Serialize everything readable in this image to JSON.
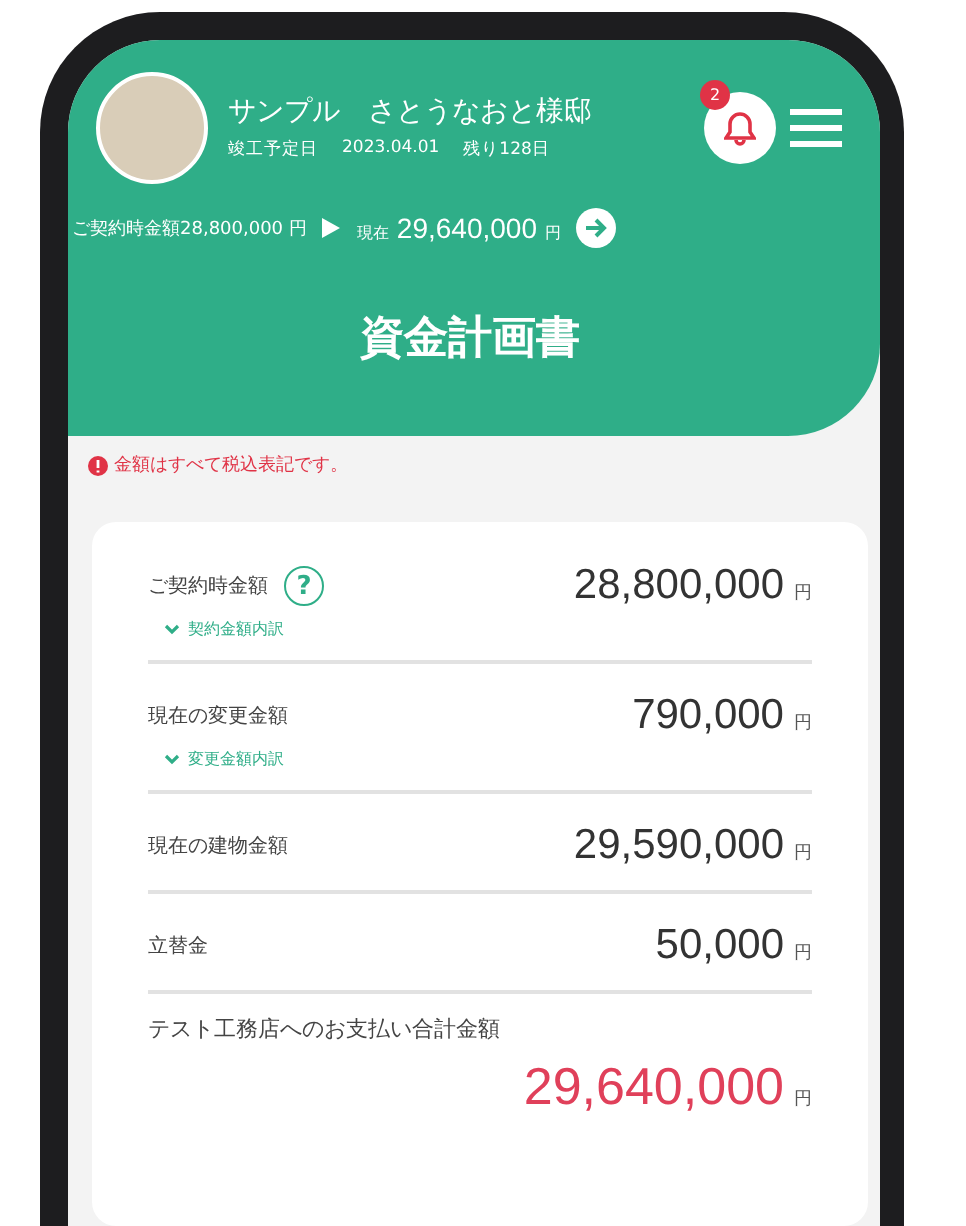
{
  "header": {
    "customer": "サンプル　さとうなおと様邸",
    "completion_label": "竣工予定日",
    "completion_date": "2023.04.01",
    "remaining": "残り128日",
    "notification_count": "2",
    "contract_summary": "ご契約時金額28,800,000 円",
    "current_label": "現在",
    "current_amount": "29,640,000",
    "current_unit": "円",
    "title": "資金計画書"
  },
  "notice": "金額はすべて税込表記です。",
  "rows": [
    {
      "kind": "amount",
      "label": "ご契約時金額",
      "help": "?",
      "amount": "28,800,000",
      "unit": "円",
      "link": "契約金額内訳"
    },
    {
      "kind": "amount",
      "label": "現在の変更金額",
      "amount": "790,000",
      "unit": "円",
      "link": "変更金額内訳"
    },
    {
      "kind": "amount",
      "label": "現在の建物金額",
      "amount": "29,590,000",
      "unit": "円"
    },
    {
      "kind": "amount",
      "label": "立替金",
      "amount": "50,000",
      "unit": "円"
    },
    {
      "kind": "total",
      "label": "テスト工務店へのお支払い合計金額",
      "amount": "29,640,000",
      "unit": "円"
    }
  ]
}
